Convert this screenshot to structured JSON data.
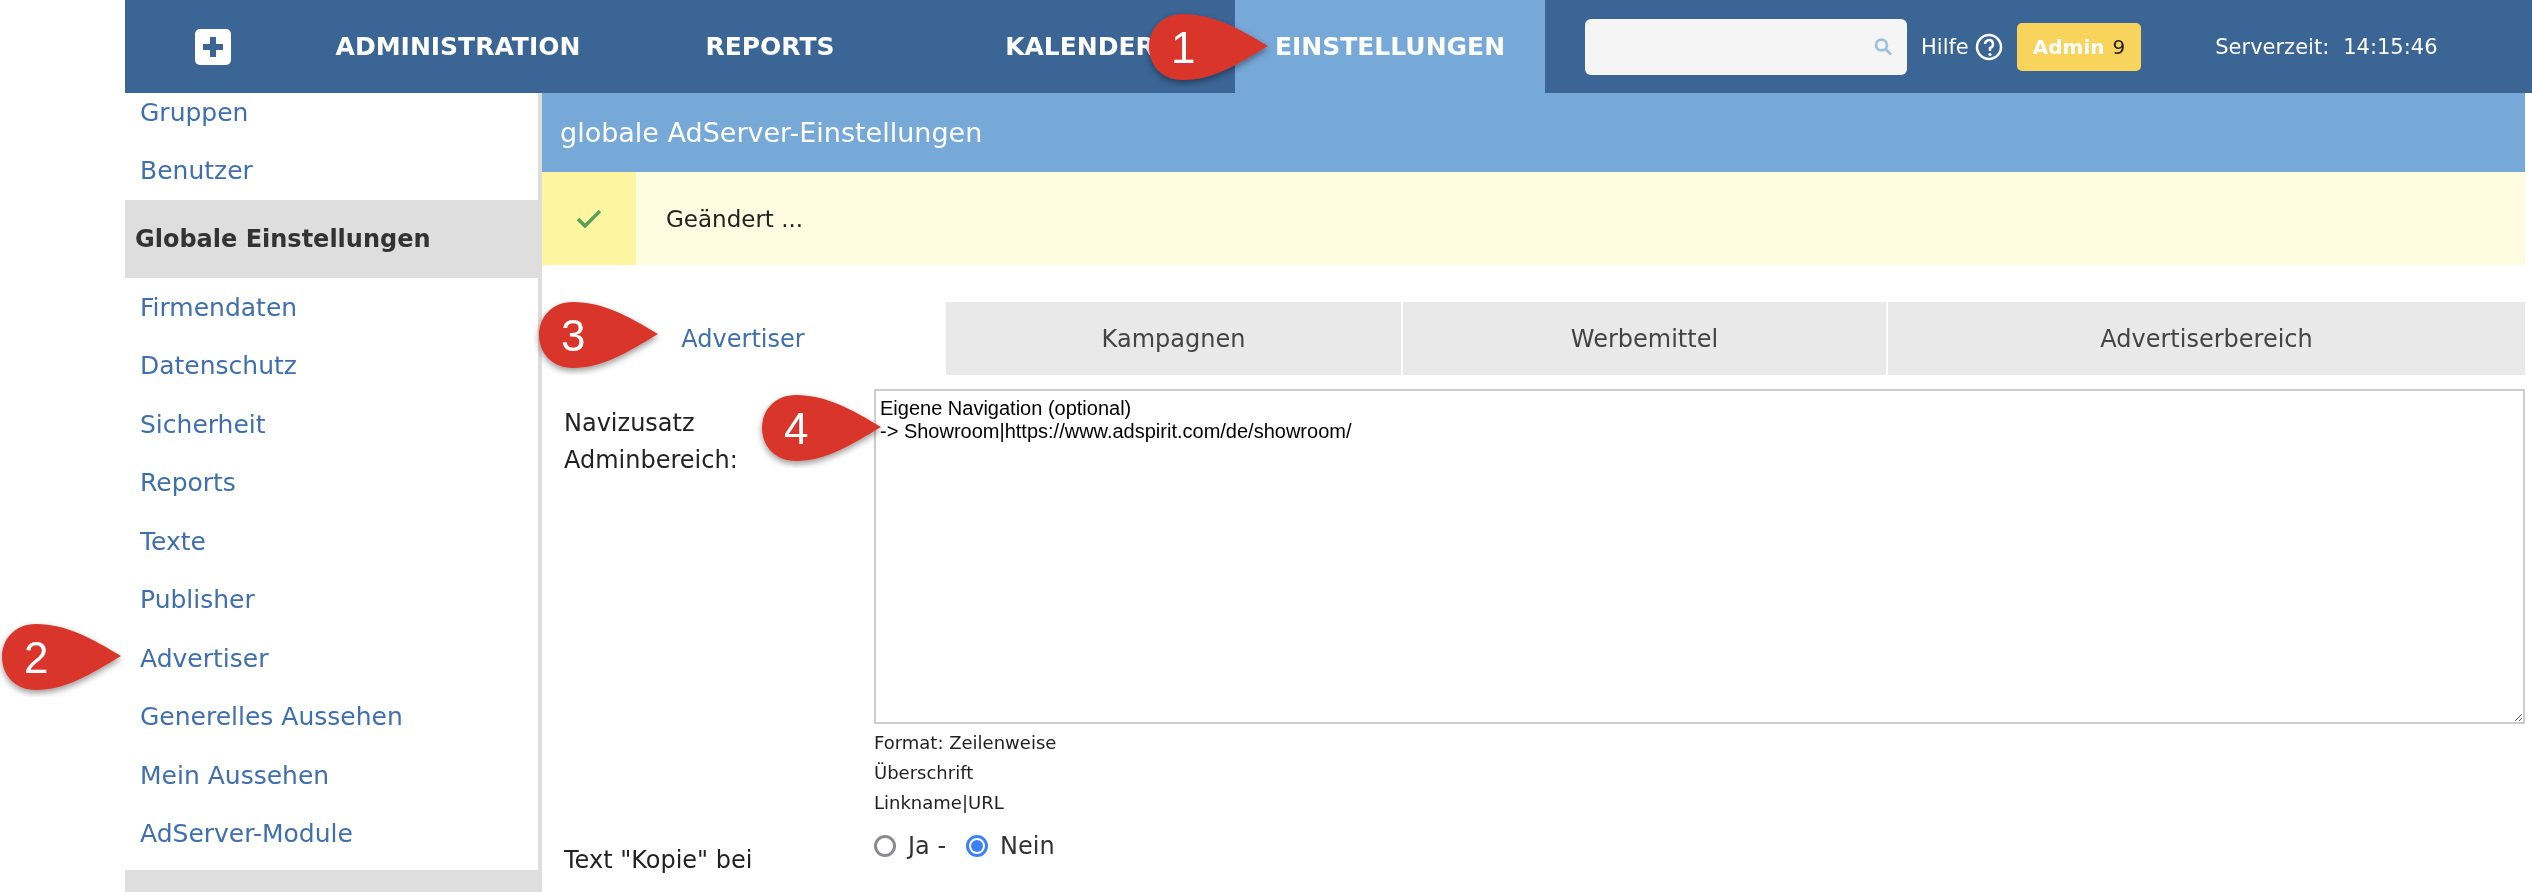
{
  "topnav": {
    "items": [
      {
        "label": "ADMINISTRATION",
        "selected": false
      },
      {
        "label": "REPORTS",
        "selected": false
      },
      {
        "label": "KALENDER",
        "selected": false
      },
      {
        "label": "EINSTELLUNGEN",
        "selected": true
      }
    ],
    "help": "Hilfe",
    "user": {
      "name": "Admin",
      "count": "9"
    },
    "server_time_label": "Serverzeit:",
    "server_time": "14:15:46"
  },
  "sidebar": {
    "items": [
      {
        "label": "Gruppen",
        "kind": "link",
        "selected": false
      },
      {
        "label": "Benutzer",
        "kind": "link",
        "selected": false
      },
      {
        "label": "Globale Einstellungen",
        "kind": "heading",
        "selected": true
      },
      {
        "label": "Firmendaten",
        "kind": "link",
        "selected": false
      },
      {
        "label": "Datenschutz",
        "kind": "link",
        "selected": false
      },
      {
        "label": "Sicherheit",
        "kind": "link",
        "selected": false
      },
      {
        "label": "Reports",
        "kind": "link",
        "selected": false
      },
      {
        "label": "Texte",
        "kind": "link",
        "selected": false
      },
      {
        "label": "Publisher",
        "kind": "link",
        "selected": false
      },
      {
        "label": "Advertiser",
        "kind": "link",
        "selected": false
      },
      {
        "label": "Generelles Aussehen",
        "kind": "link",
        "selected": false
      },
      {
        "label": "Mein Aussehen",
        "kind": "link",
        "selected": false
      },
      {
        "label": "AdServer-Module",
        "kind": "link",
        "selected": false
      }
    ]
  },
  "page_title": "globale AdServer-Einstellungen",
  "notice": {
    "text": "Geändert ..."
  },
  "tabs": [
    {
      "label": "Advertiser",
      "selected": true
    },
    {
      "label": "Kampagnen",
      "selected": false
    },
    {
      "label": "Werbemittel",
      "selected": false
    },
    {
      "label": "Advertiserbereich",
      "selected": false
    }
  ],
  "form": {
    "navizusatz": {
      "label_lines": [
        "Navizusatz",
        "Adminbereich:"
      ],
      "value": "Eigene Navigation (optional)\n-> Showroom|https://www.adspirit.com/de/showroom/",
      "hint_lines": [
        "Format: Zeilenweise",
        "Überschrift",
        "Linkname|URL"
      ]
    },
    "kopie": {
      "label": "Text \"Kopie\" bei",
      "options": [
        {
          "label": "Ja -",
          "selected": false
        },
        {
          "label": "Nein",
          "selected": true
        }
      ]
    }
  },
  "annotations": [
    {
      "label": "1"
    },
    {
      "label": "2"
    },
    {
      "label": "3"
    },
    {
      "label": "4"
    }
  ]
}
